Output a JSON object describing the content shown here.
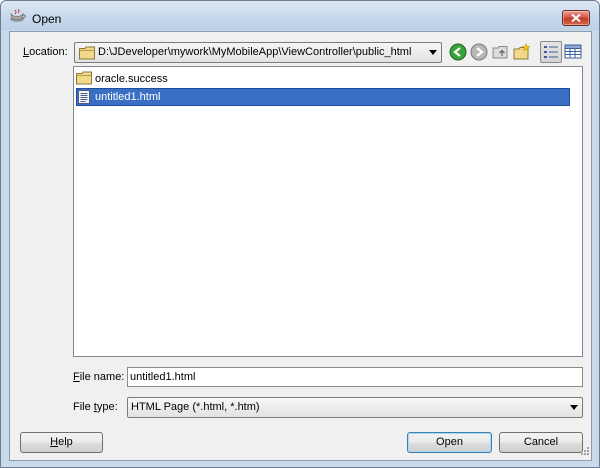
{
  "window": {
    "title": "Open",
    "icon": "coffee-cup-icon"
  },
  "location": {
    "label_prefix": "L",
    "label_rest": "ocation:",
    "value": "D:\\JDeveloper\\mywork\\MyMobileApp\\ViewController\\public_html"
  },
  "toolbar": {
    "icons": [
      "back-green-icon",
      "forward-icon",
      "folder-up-icon",
      "new-folder-icon",
      "list-view-icon",
      "details-view-icon"
    ]
  },
  "files": [
    {
      "name": "oracle.success",
      "type": "folder",
      "selected": false
    },
    {
      "name": "untitled1.html",
      "type": "file",
      "selected": true
    }
  ],
  "file_name": {
    "label_prefix": "F",
    "label_rest": "ile name:",
    "value": "untitled1.html"
  },
  "file_type": {
    "label_prefix": "File ",
    "label_ul": "t",
    "label_rest": "ype:",
    "selected": "HTML Page (*.html, *.htm)"
  },
  "buttons": {
    "help_ul": "H",
    "help_rest": "elp",
    "open": "Open",
    "cancel": "Cancel"
  },
  "colors": {
    "selection": "#3a6fc4",
    "title_gradient": "#c7d9ec",
    "close_red": "#c23a2b"
  }
}
